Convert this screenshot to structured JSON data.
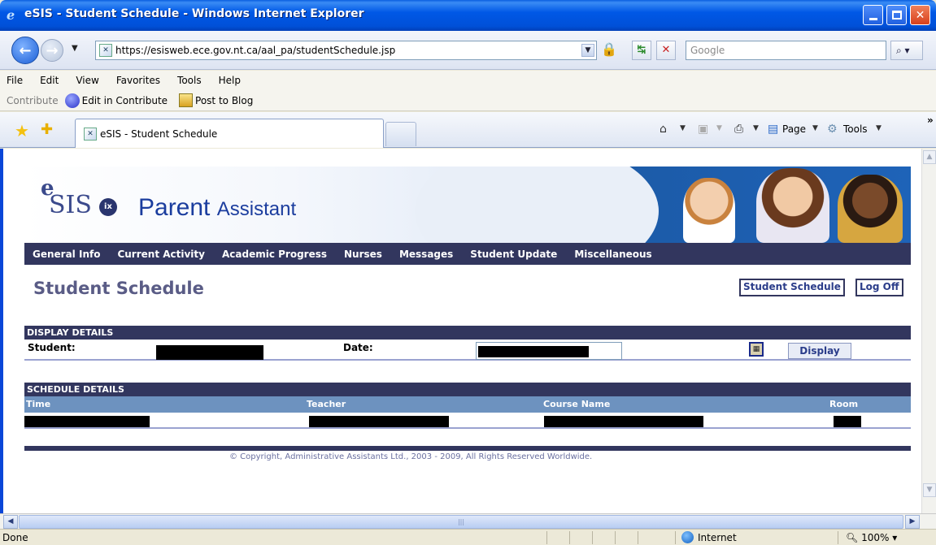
{
  "window": {
    "title": "eSIS - Student Schedule - Windows Internet Explorer"
  },
  "address": {
    "url": "https://esisweb.ece.gov.nt.ca/aal_pa/studentSchedule.jsp",
    "search_placeholder": "Google"
  },
  "menu": [
    "File",
    "Edit",
    "View",
    "Favorites",
    "Tools",
    "Help"
  ],
  "contribute": {
    "label": "Contribute",
    "edit": "Edit in Contribute",
    "post": "Post to Blog"
  },
  "tabs": {
    "active": "eSIS - Student Schedule"
  },
  "commandbar": {
    "page": "Page",
    "tools": "Tools"
  },
  "brand": {
    "logo_e": "e",
    "logo_sis": "SIS",
    "logo_badge": "ix",
    "title_main": "Parent",
    "title_sub": "Assistant"
  },
  "nav": [
    "General Info",
    "Current Activity",
    "Academic Progress",
    "Nurses",
    "Messages",
    "Student Update",
    "Miscellaneous"
  ],
  "page": {
    "title": "Student Schedule",
    "schedule_btn": "Student Schedule",
    "logoff_btn": "Log Off"
  },
  "display_details": {
    "heading": "DISPLAY DETAILS",
    "student_label": "Student:",
    "date_label": "Date:",
    "display_btn": "Display"
  },
  "schedule_details": {
    "heading": "SCHEDULE DETAILS",
    "columns": [
      "Time",
      "Teacher",
      "Course Name",
      "Room"
    ]
  },
  "footer": {
    "copyright": "© Copyright, Administrative Assistants Ltd., 2003 - 2009, All Rights Reserved Worldwide."
  },
  "status": {
    "text": "Done",
    "zone": "Internet",
    "zoom": "100%"
  }
}
